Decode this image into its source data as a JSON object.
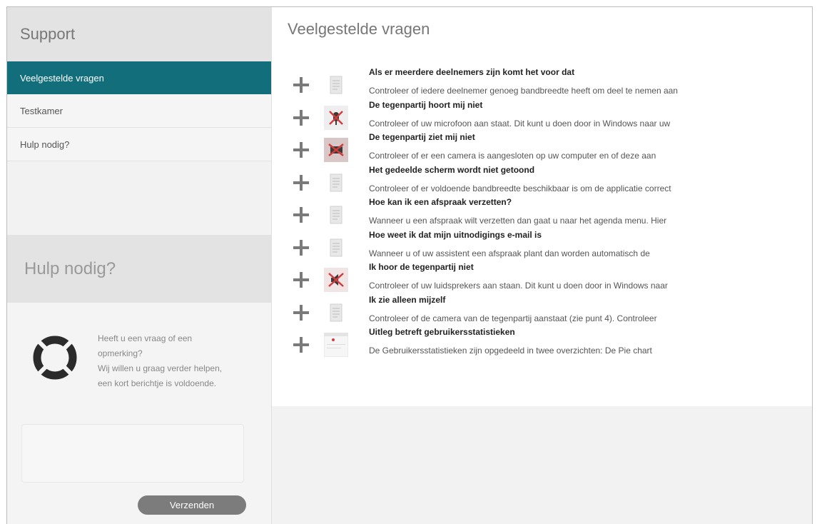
{
  "sidebar": {
    "title": "Support",
    "items": [
      {
        "label": "Veelgestelde vragen"
      },
      {
        "label": "Testkamer"
      },
      {
        "label": "Hulp nodig?"
      }
    ]
  },
  "help": {
    "title": "Hulp nodig?",
    "lines": [
      "Heeft u een vraag of een",
      "opmerking?",
      "Wij willen u graag verder helpen,",
      "een kort berichtje is voldoende."
    ],
    "send_label": "Verzenden"
  },
  "main": {
    "title": "Veelgestelde vragen",
    "faqs": [
      {
        "title": "Als er meerdere deelnemers zijn komt het voor dat",
        "desc": "Controleer of iedere deelnemer genoeg bandbreedte heeft om deel te nemen aan",
        "icon": "document-icon"
      },
      {
        "title": "De tegenpartij hoort mij niet",
        "desc": "Controleer of uw microfoon aan staat. Dit kunt u doen door in Windows naar uw",
        "icon": "muted-microphone-icon"
      },
      {
        "title": "De tegenpartij ziet mij niet",
        "desc": "Controleer of er een camera is aangesloten op uw computer en of deze aan",
        "icon": "camera-off-icon"
      },
      {
        "title": "Het gedeelde scherm wordt niet getoond",
        "desc": "Controleer of er voldoende bandbreedte beschikbaar is om de applicatie correct",
        "icon": "document-icon"
      },
      {
        "title": "Hoe kan ik een afspraak verzetten?",
        "desc": "Wanneer u een afspraak wilt verzetten dan gaat u naar het agenda menu. Hier",
        "icon": "document-icon"
      },
      {
        "title": "Hoe weet ik dat mijn uitnodigings e-mail is",
        "desc": "Wanneer u of uw assistent een afspraak plant dan worden automatisch de",
        "icon": "document-icon"
      },
      {
        "title": "Ik hoor de tegenpartij niet",
        "desc": "Controleer of uw luidsprekers aan staan. Dit kunt u doen door in Windows naar",
        "icon": "speaker-muted-icon"
      },
      {
        "title": "Ik zie alleen mijzelf",
        "desc": "Controleer of de camera van de tegenpartij aanstaat (zie punt 4). Controleer",
        "icon": "document-icon"
      },
      {
        "title": "Uitleg betreft gebruikersstatistieken",
        "desc": "De Gebruikersstatistieken zijn opgedeeld in twee overzichten: De Pie chart",
        "icon": "statistics-screenshot-icon"
      }
    ]
  },
  "colors": {
    "accent": "#136e7b",
    "sidebar_bg": "#f2f2f2",
    "header_bg": "#e3e3e3",
    "button_bg": "#7c7c7c"
  }
}
